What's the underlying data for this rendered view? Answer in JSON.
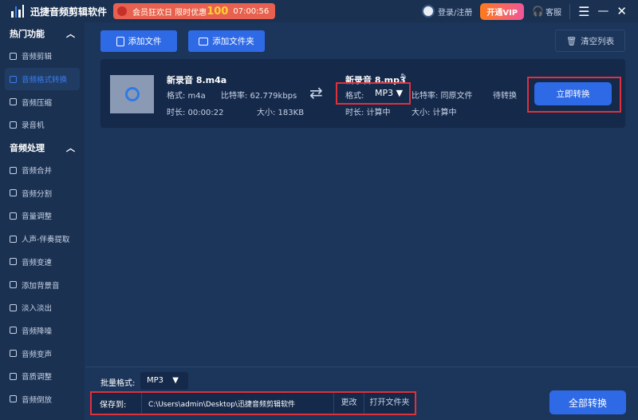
{
  "header": {
    "app_title": "迅捷音频剪辑软件",
    "promo_text": "会员狂欢日 限时优惠",
    "promo_amount": "100",
    "promo_timer": "07:00:56",
    "login": "登录/注册",
    "vip": "开通VIP",
    "service": "客服"
  },
  "sidebar": {
    "sections": [
      {
        "title": "热门功能",
        "items": [
          "音频剪辑",
          "音频格式转换",
          "音频压缩",
          "录音机"
        ]
      },
      {
        "title": "音频处理",
        "items": [
          "音频合并",
          "音频分割",
          "音量调整",
          "人声-伴奏提取",
          "音频变速",
          "添加背景音",
          "淡入淡出",
          "音频降噪",
          "音频变声",
          "音质调整",
          "音频倒放"
        ]
      }
    ],
    "active": "音频格式转换"
  },
  "toolbar": {
    "add_file": "添加文件",
    "add_folder": "添加文件夹",
    "clear": "清空列表"
  },
  "file": {
    "src_name": "新录音 8.m4a",
    "src_format": "格式:  m4a",
    "src_bitrate": "比特率: 62.779kbps",
    "src_duration": "时长:  00:00:22",
    "src_size": "大小:  183KB",
    "out_name": "新录音 8.mp3",
    "format_label": "格式:",
    "format_value": "MP3",
    "out_bitrate": "比特率: 同原文件",
    "status": "待转换",
    "out_duration": "时长: 计算中",
    "out_size": "大小: 计算中",
    "convert": "立即转换"
  },
  "footer": {
    "batch_label": "批量格式:",
    "batch_value": "MP3",
    "save_label": "保存到:",
    "save_path": "C:\\Users\\admin\\Desktop\\迅捷音频剪辑软件",
    "change": "更改",
    "open_folder": "打开文件夹",
    "convert_all": "全部转换"
  }
}
